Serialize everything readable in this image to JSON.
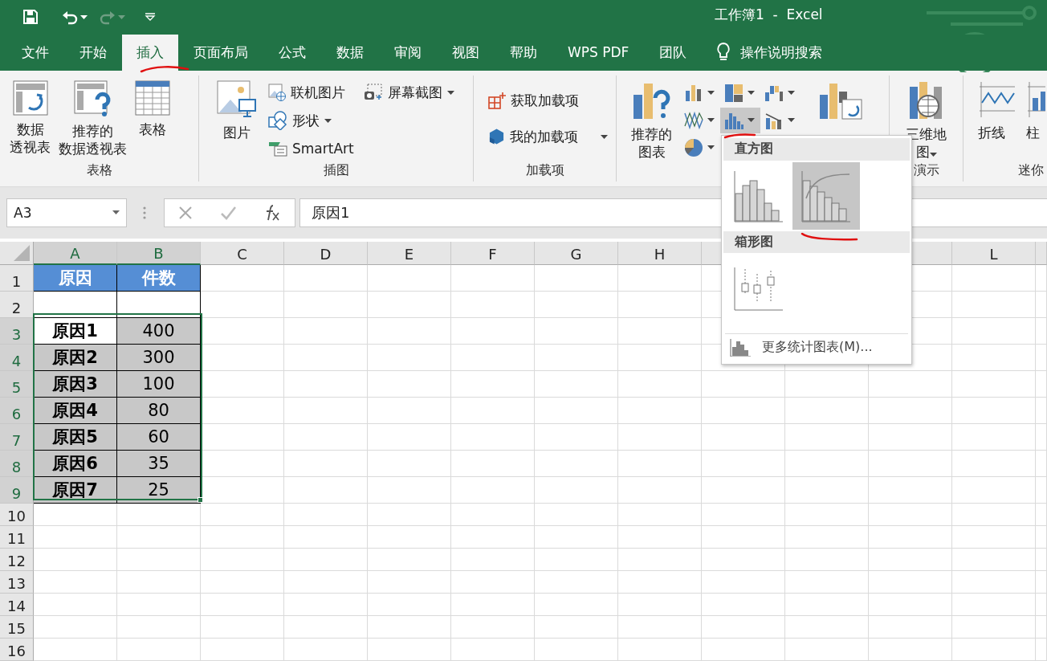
{
  "window": {
    "title": "工作簿1  -  Excel"
  },
  "quick_access": {
    "redo": {
      "disabled": true
    }
  },
  "tabs": [
    {
      "label": "文件",
      "selected": false
    },
    {
      "label": "开始",
      "selected": false
    },
    {
      "label": "插入",
      "selected": true
    },
    {
      "label": "页面布局",
      "selected": false
    },
    {
      "label": "公式",
      "selected": false
    },
    {
      "label": "数据",
      "selected": false
    },
    {
      "label": "审阅",
      "selected": false
    },
    {
      "label": "视图",
      "selected": false
    },
    {
      "label": "帮助",
      "selected": false
    },
    {
      "label": "WPS PDF",
      "selected": false
    },
    {
      "label": "团队",
      "selected": false
    }
  ],
  "tell_me": {
    "placeholder": "操作说明搜索"
  },
  "ribbon": {
    "tables": {
      "label": "表格",
      "buttons": [
        {
          "lines": [
            "数据",
            "透视表"
          ]
        },
        {
          "lines": [
            "推荐的",
            "数据透视表"
          ]
        },
        {
          "lines": [
            "表格"
          ]
        }
      ]
    },
    "illustrations": {
      "label": "插图",
      "picture": "图片",
      "small": [
        {
          "label": "联机图片",
          "dropdown": false
        },
        {
          "label": "形状",
          "dropdown": true
        },
        {
          "label": "SmartArt",
          "dropdown": false
        },
        {
          "label": "屏幕截图",
          "dropdown": true
        }
      ]
    },
    "addins": {
      "label": "加载项",
      "items": [
        {
          "label": "获取加载项",
          "dropdown": false
        },
        {
          "label": "我的加载项",
          "dropdown": true
        }
      ]
    },
    "charts": {
      "recommended": [
        "推荐的",
        "图表"
      ],
      "chart_buttons": [
        {
          "kind": "column",
          "expanded": false
        },
        {
          "kind": "hierarchy",
          "expanded": false
        },
        {
          "kind": "waterfall",
          "expanded": false
        },
        {
          "kind": "line",
          "expanded": false
        },
        {
          "kind": "statistic",
          "expanded": true
        },
        {
          "kind": "combo",
          "expanded": false
        },
        {
          "kind": "pie",
          "expanded": false
        }
      ]
    },
    "tours": {
      "label": "演示",
      "map": [
        "三维地",
        "图"
      ]
    },
    "sparklines": {
      "label": "迷你",
      "buttons": [
        "折线",
        "柱"
      ]
    }
  },
  "formula_bar": {
    "name_box": "A3",
    "value": "原因1"
  },
  "sheet": {
    "columns": [
      {
        "label": "A",
        "selected": true
      },
      {
        "label": "B",
        "selected": true
      },
      {
        "label": "C",
        "selected": false
      },
      {
        "label": "D",
        "selected": false
      },
      {
        "label": "E",
        "selected": false
      },
      {
        "label": "F",
        "selected": false
      },
      {
        "label": "G",
        "selected": false
      },
      {
        "label": "H",
        "selected": false
      },
      {
        "label": "L",
        "selected": false
      }
    ],
    "rows": [
      {
        "number": "1",
        "selected": false,
        "cells": [
          {
            "text": "原因",
            "kind": "header"
          },
          {
            "text": "件数",
            "kind": "header"
          }
        ]
      },
      {
        "number": "2",
        "selected": false,
        "cells": [
          {
            "kind": "blank"
          },
          {
            "kind": "blank"
          }
        ]
      },
      {
        "number": "3",
        "selected": true,
        "cells": [
          {
            "text": "原因1",
            "kind": "label",
            "selected": false
          },
          {
            "text": "400",
            "kind": "value",
            "selected": true
          }
        ]
      },
      {
        "number": "4",
        "selected": true,
        "cells": [
          {
            "text": "原因2",
            "kind": "label",
            "selected": true
          },
          {
            "text": "300",
            "kind": "value",
            "selected": true
          }
        ]
      },
      {
        "number": "5",
        "selected": true,
        "cells": [
          {
            "text": "原因3",
            "kind": "label",
            "selected": true
          },
          {
            "text": "100",
            "kind": "value",
            "selected": true
          }
        ]
      },
      {
        "number": "6",
        "selected": true,
        "cells": [
          {
            "text": "原因4",
            "kind": "label",
            "selected": true
          },
          {
            "text": "80",
            "kind": "value",
            "selected": true
          }
        ]
      },
      {
        "number": "7",
        "selected": true,
        "cells": [
          {
            "text": "原因5",
            "kind": "label",
            "selected": true
          },
          {
            "text": "60",
            "kind": "value",
            "selected": true
          }
        ]
      },
      {
        "number": "8",
        "selected": true,
        "cells": [
          {
            "text": "原因6",
            "kind": "label",
            "selected": true
          },
          {
            "text": "35",
            "kind": "value",
            "selected": true
          }
        ]
      },
      {
        "number": "9",
        "selected": true,
        "cells": [
          {
            "text": "原因7",
            "kind": "label",
            "selected": true
          },
          {
            "text": "25",
            "kind": "value",
            "selected": true
          }
        ]
      },
      {
        "number": "10",
        "selected": false
      },
      {
        "number": "11",
        "selected": false
      },
      {
        "number": "12",
        "selected": false
      },
      {
        "number": "13",
        "selected": false
      },
      {
        "number": "14",
        "selected": false
      },
      {
        "number": "15",
        "selected": false
      },
      {
        "number": "16",
        "selected": false
      }
    ]
  },
  "chart_menu": {
    "sections": [
      {
        "title": "直方图",
        "items": [
          {
            "kind": "histogram",
            "selected": false
          },
          {
            "kind": "pareto",
            "selected": true
          }
        ]
      },
      {
        "title": "箱形图",
        "items": [
          {
            "kind": "box",
            "selected": false
          }
        ]
      }
    ],
    "more": "更多统计图表(M)..."
  }
}
